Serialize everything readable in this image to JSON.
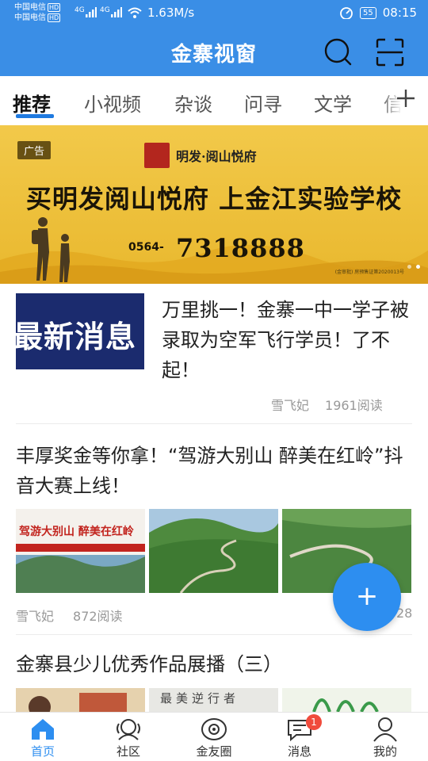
{
  "status_bar": {
    "carrier1": "中国电信",
    "carrier2": "中国电信",
    "hd_badge": "HD",
    "signal1": "4G",
    "signal2": "4G",
    "speed": "1.63M/s",
    "battery": "55",
    "time": "08:15"
  },
  "header": {
    "title": "金寨视窗",
    "search_icon": "search-icon",
    "scan_icon": "scan-icon"
  },
  "tabs": {
    "items": [
      {
        "label": "推荐",
        "active": true
      },
      {
        "label": "小视频"
      },
      {
        "label": "杂谈"
      },
      {
        "label": "问寻"
      },
      {
        "label": "文学"
      },
      {
        "label": "信"
      }
    ],
    "add_icon": "plus-icon"
  },
  "banner": {
    "ad_label": "广告",
    "brand": "明发·阅山悦府",
    "slogan": "买明发阅山悦府 上金江实验学校",
    "phone_prefix": "0564-",
    "phone": "7318888",
    "note": "(金审批) 房预售证第2020013号",
    "page_count": 2,
    "active_page": 2
  },
  "articles": [
    {
      "thumb_text": "最新消息",
      "title": "万里挑一！金寨一中一学子被录取为空军飞行学员！了不起！",
      "author": "雪飞妃",
      "reads": "1961阅读"
    },
    {
      "title": "丰厚奖金等你拿！“驾游大别山 醉美在红岭”抖音大赛上线！",
      "img1_text": "驾游大别山 醉美在红岭",
      "author": "雪飞妃",
      "reads": "872阅读",
      "right_meta": "28"
    },
    {
      "title": "金寨县少儿优秀作品展播（三）",
      "img2_text": "最美逆行者"
    }
  ],
  "fab": {
    "label": "+"
  },
  "bottom_nav": {
    "items": [
      {
        "label": "首页",
        "icon": "home-icon",
        "active": true
      },
      {
        "label": "社区",
        "icon": "community-icon"
      },
      {
        "label": "金友圈",
        "icon": "circle-icon"
      },
      {
        "label": "消息",
        "icon": "message-icon",
        "badge": "1"
      },
      {
        "label": "我的",
        "icon": "profile-icon"
      }
    ]
  },
  "colors": {
    "primary": "#3a8ee6",
    "accent": "#2d8ef0",
    "badge": "#f04b3c",
    "banner": "#f2c94a"
  }
}
